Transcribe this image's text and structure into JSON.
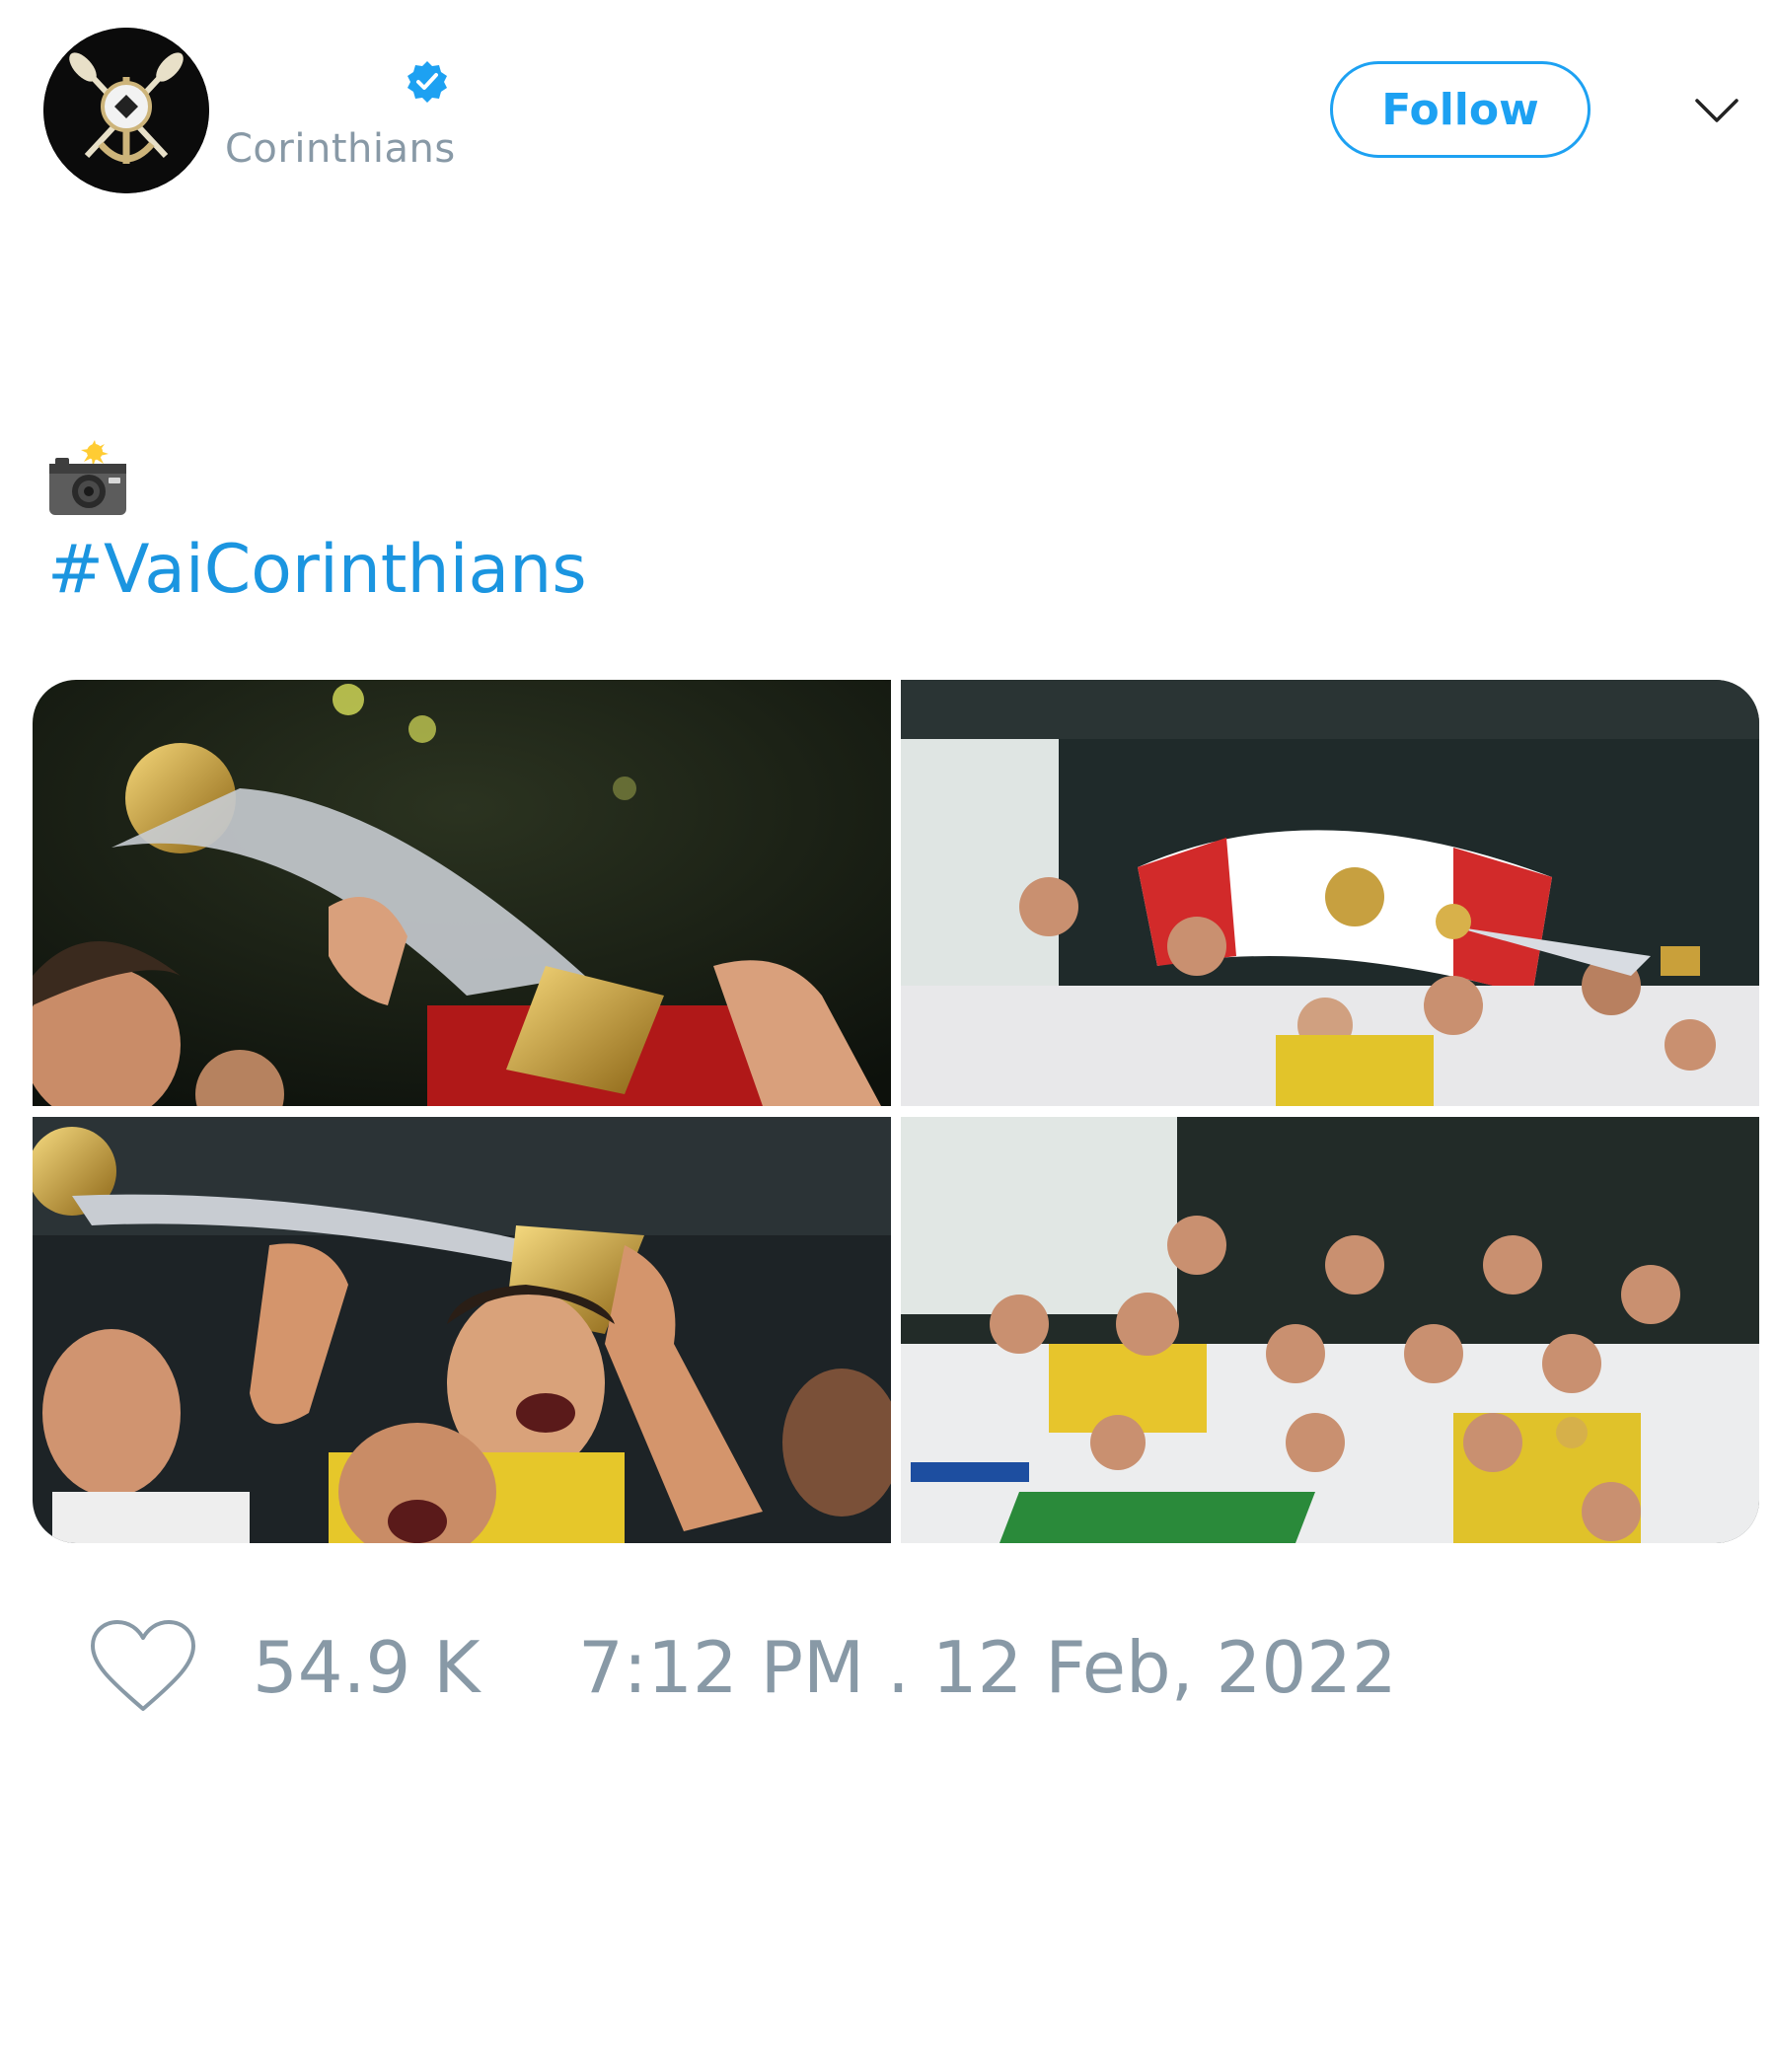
{
  "tweet": {
    "author": {
      "handle": "Corinthians",
      "verified": true,
      "avatar_icon": "corinthians-crest-icon"
    },
    "follow_label": "Follow",
    "menu_icon": "chevron-down-icon",
    "text": {
      "emoji": "📸",
      "hashtag": "#VaiCorinthians"
    },
    "media": [
      {
        "label": "photo-trophy-closeup"
      },
      {
        "label": "photo-team-celebration-flag"
      },
      {
        "label": "photo-trophy-raised"
      },
      {
        "label": "photo-team-group-celebration"
      }
    ],
    "likes": "54.9 K",
    "timestamp": "7:12 PM . 12 Feb, 2022"
  },
  "colors": {
    "accent": "#1da1f2",
    "hashtag": "#1b95e0",
    "muted": "#8899a6",
    "background": "#ffffff"
  }
}
